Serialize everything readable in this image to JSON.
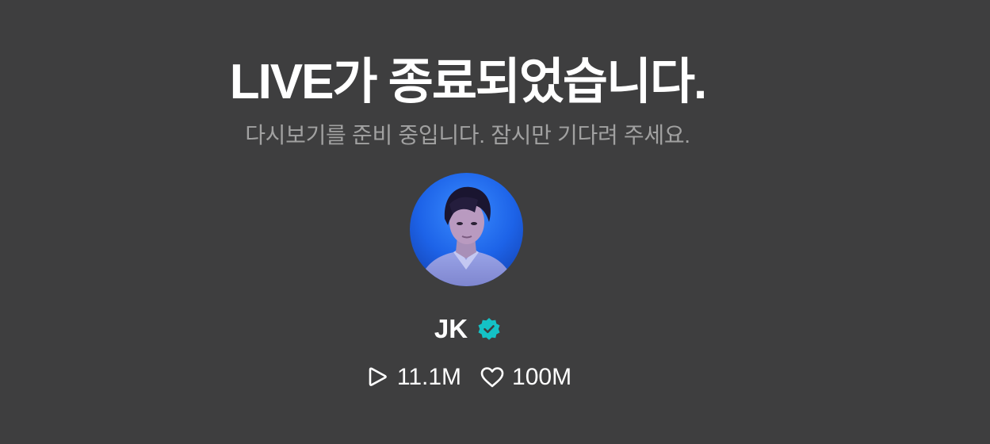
{
  "status": {
    "title": "LIVE가 종료되었습니다.",
    "subtitle": "다시보기를 준비 중입니다. 잠시만 기다려 주세요."
  },
  "profile": {
    "name": "JK",
    "verified_icon": "verified-badge-icon",
    "avatar_description": "profile-avatar"
  },
  "stats": {
    "plays": {
      "icon": "play-icon",
      "value": "11.1M"
    },
    "likes": {
      "icon": "heart-icon",
      "value": "100M"
    }
  },
  "colors": {
    "background": "#3e3e3f",
    "text": "#ffffff",
    "subtext": "#a1a1a1",
    "badge": "#14c2c6",
    "avatar_bg": "#1e6be6"
  }
}
